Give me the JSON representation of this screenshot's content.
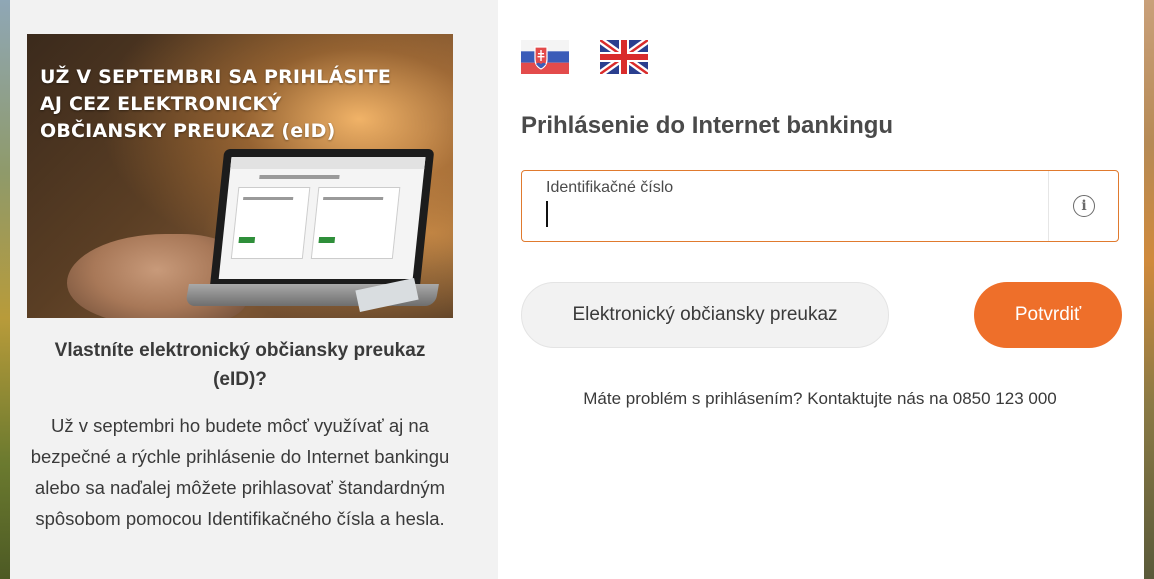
{
  "promo": {
    "headline_line1": "UŽ V SEPTEMBRI SA PRIHLÁSITE",
    "headline_line2": "AJ CEZ ELEKTRONICKÝ",
    "headline_line3": "OBČIANSKY PREUKAZ (eID)",
    "title": "Vlastníte elektronický občiansky preukaz (eID)?",
    "text": "Už v septembri ho budete môcť využívať aj na bezpečné a rýchle prihlásenie do Internet bankingu alebo sa naďalej môžete prihlasovať štandardným spôsobom pomocou Identifikačného čísla a hesla."
  },
  "languages": [
    {
      "code": "sk",
      "icon": "slovak-flag-icon"
    },
    {
      "code": "en",
      "icon": "uk-flag-icon"
    }
  ],
  "login": {
    "title": "Prihlásenie do Internet bankingu",
    "id_label": "Identifikačné číslo",
    "id_value": "",
    "info_icon": "info-icon",
    "eid_button": "Elektronický občiansky preukaz",
    "submit_button": "Potvrdiť",
    "help": "Máte problém s prihlásením? Kontaktujte nás na 0850 123 000"
  },
  "colors": {
    "accent": "#ee6f2a",
    "field_border": "#e07a2e",
    "left_panel_bg": "#f2f2f2",
    "text": "#3a3a3a"
  }
}
